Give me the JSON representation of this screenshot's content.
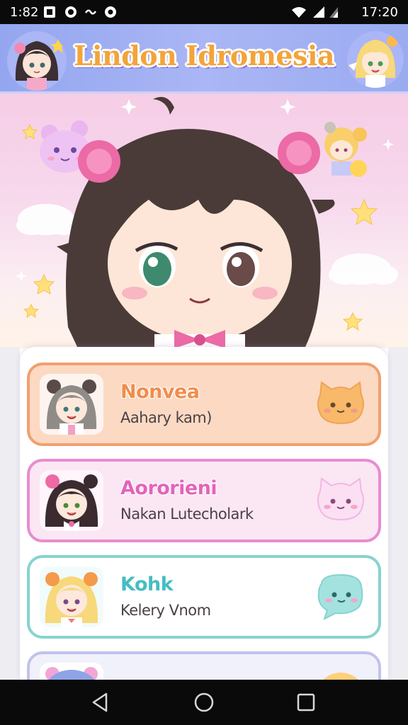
{
  "status_bar": {
    "time_left": "1:82",
    "time_right": "17:20",
    "icons": [
      "app-icon",
      "circle-app-icon",
      "link-icon",
      "camera-icon",
      "wifi-icon",
      "signal-icon",
      "battery-icon"
    ]
  },
  "header": {
    "title": "Lindon Idromesia"
  },
  "contacts": [
    {
      "name": "Nonvea",
      "subtitle": "Aahary kam)",
      "accent": "#f0a070",
      "bg": "#fcd9c3",
      "name_color": "#f08d4e",
      "chat_icon": "cat-chat-icon",
      "chat_color": "#f8b96a"
    },
    {
      "name": "Aororieni",
      "subtitle": "Nakan Lutecholark",
      "accent": "#e98ccf",
      "bg": "#fbe6f4",
      "name_color": "#e463b9",
      "chat_icon": "cat-chat-icon",
      "chat_color": "#f6c7ea"
    },
    {
      "name": "Kohk",
      "subtitle": "Kelery Vnom",
      "accent": "#86d3cf",
      "bg": "#ffffff",
      "name_color": "#45bdc2",
      "chat_icon": "speech-bubble-icon",
      "chat_color": "#a4e2e0"
    }
  ],
  "colors": {
    "header_bg": "#9fb0f2",
    "title": "#f2a43a",
    "hero_bg": "#f6cde6"
  },
  "nav": {
    "icons": [
      "back-icon",
      "home-icon",
      "recents-icon"
    ]
  }
}
